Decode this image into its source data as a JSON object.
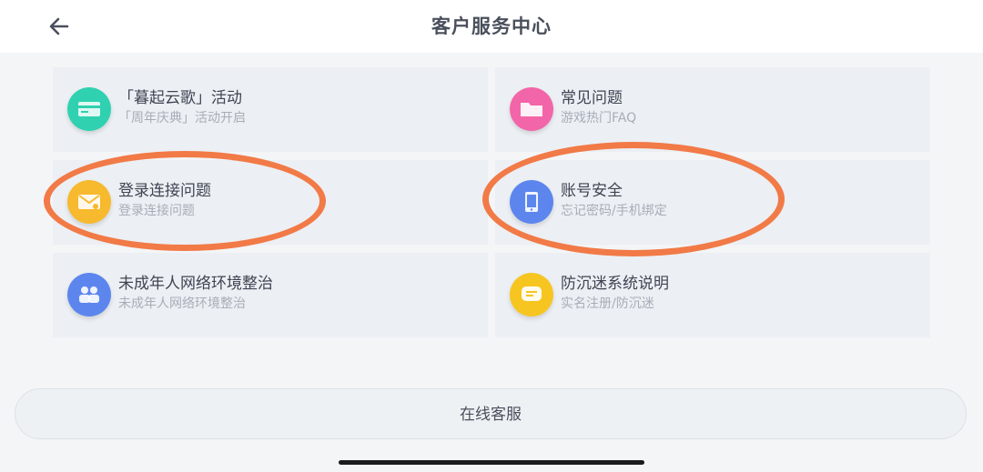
{
  "header": {
    "title": "客户服务中心",
    "back_icon": "arrow-left-icon"
  },
  "cards": [
    {
      "title": "「暮起云歌」活动",
      "subtitle": "「周年庆典」活动开启",
      "icon": "card-icon",
      "icon_color": "#2fd1b0"
    },
    {
      "title": "常见问题",
      "subtitle": "游戏热门FAQ",
      "icon": "folder-icon",
      "icon_color": "#f265a8"
    },
    {
      "title": "登录连接问题",
      "subtitle": "登录连接问题",
      "icon": "mail-icon",
      "icon_color": "#f7b92d"
    },
    {
      "title": "账号安全",
      "subtitle": "忘记密码/手机绑定",
      "icon": "phone-icon",
      "icon_color": "#5c86ee"
    },
    {
      "title": "未成年人网络环境整治",
      "subtitle": "未成年人网络环境整治",
      "icon": "people-icon",
      "icon_color": "#5c86ee"
    },
    {
      "title": "防沉迷系统说明",
      "subtitle": "实名注册/防沉迷",
      "icon": "message-icon",
      "icon_color": "#f7c520"
    }
  ],
  "footer": {
    "online_service_label": "在线客服"
  },
  "colors": {
    "highlight_ring": "#f17a47",
    "card_bg": "#eceff3",
    "page_bg": "#f3f5f7"
  }
}
